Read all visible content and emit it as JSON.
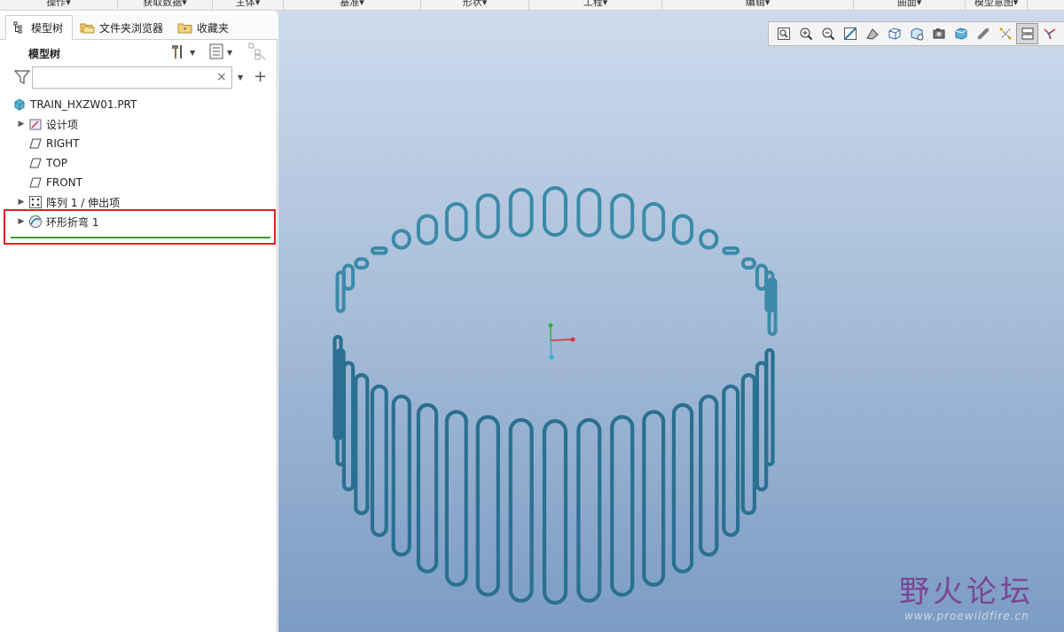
{
  "ribbon": {
    "groups": [
      "操作▾",
      "获取数据▾",
      "主体▾",
      "基准▾",
      "形状▾",
      "工程▾",
      "编辑▾",
      "曲面▾",
      "模型意图▾"
    ]
  },
  "tabs": [
    {
      "label": "模型树",
      "icon": "model-tree-icon",
      "active": true
    },
    {
      "label": "文件夹浏览器",
      "icon": "folder-browser-icon",
      "active": false
    },
    {
      "label": "收藏夹",
      "icon": "favorites-icon",
      "active": false
    }
  ],
  "panel": {
    "title": "模型树",
    "filter_value": "",
    "filter_placeholder": ""
  },
  "tree": {
    "root": "TRAIN_HXZW01.PRT",
    "items": [
      {
        "label": "设计项",
        "icon": "design-items-icon",
        "expandable": true
      },
      {
        "label": "RIGHT",
        "icon": "datum-plane-icon",
        "expandable": false
      },
      {
        "label": "TOP",
        "icon": "datum-plane-icon",
        "expandable": false
      },
      {
        "label": "FRONT",
        "icon": "datum-plane-icon",
        "expandable": false
      },
      {
        "label": "阵列 1 / 伸出项",
        "icon": "pattern-icon",
        "expandable": true
      },
      {
        "label": "环形折弯 1",
        "icon": "toroidal-bend-icon",
        "expandable": true
      }
    ]
  },
  "view_toolbar": {
    "buttons": [
      "refit-icon",
      "zoom-in-icon",
      "zoom-out-icon",
      "repaint-icon",
      "view-manager-icon",
      "display-style-icon",
      "saved-orientations-icon",
      "named-views-icon",
      "section-icon",
      "perspective-icon",
      "datum-display-icon",
      "annotation-display-icon",
      "spin-center-icon"
    ]
  },
  "watermark": {
    "title": "野火论坛",
    "url": "www.proewildfire.cn"
  },
  "colors": {
    "accent_red": "#e02020",
    "insert_green": "#3a9a2a",
    "coil_blue": "#2a7090"
  }
}
